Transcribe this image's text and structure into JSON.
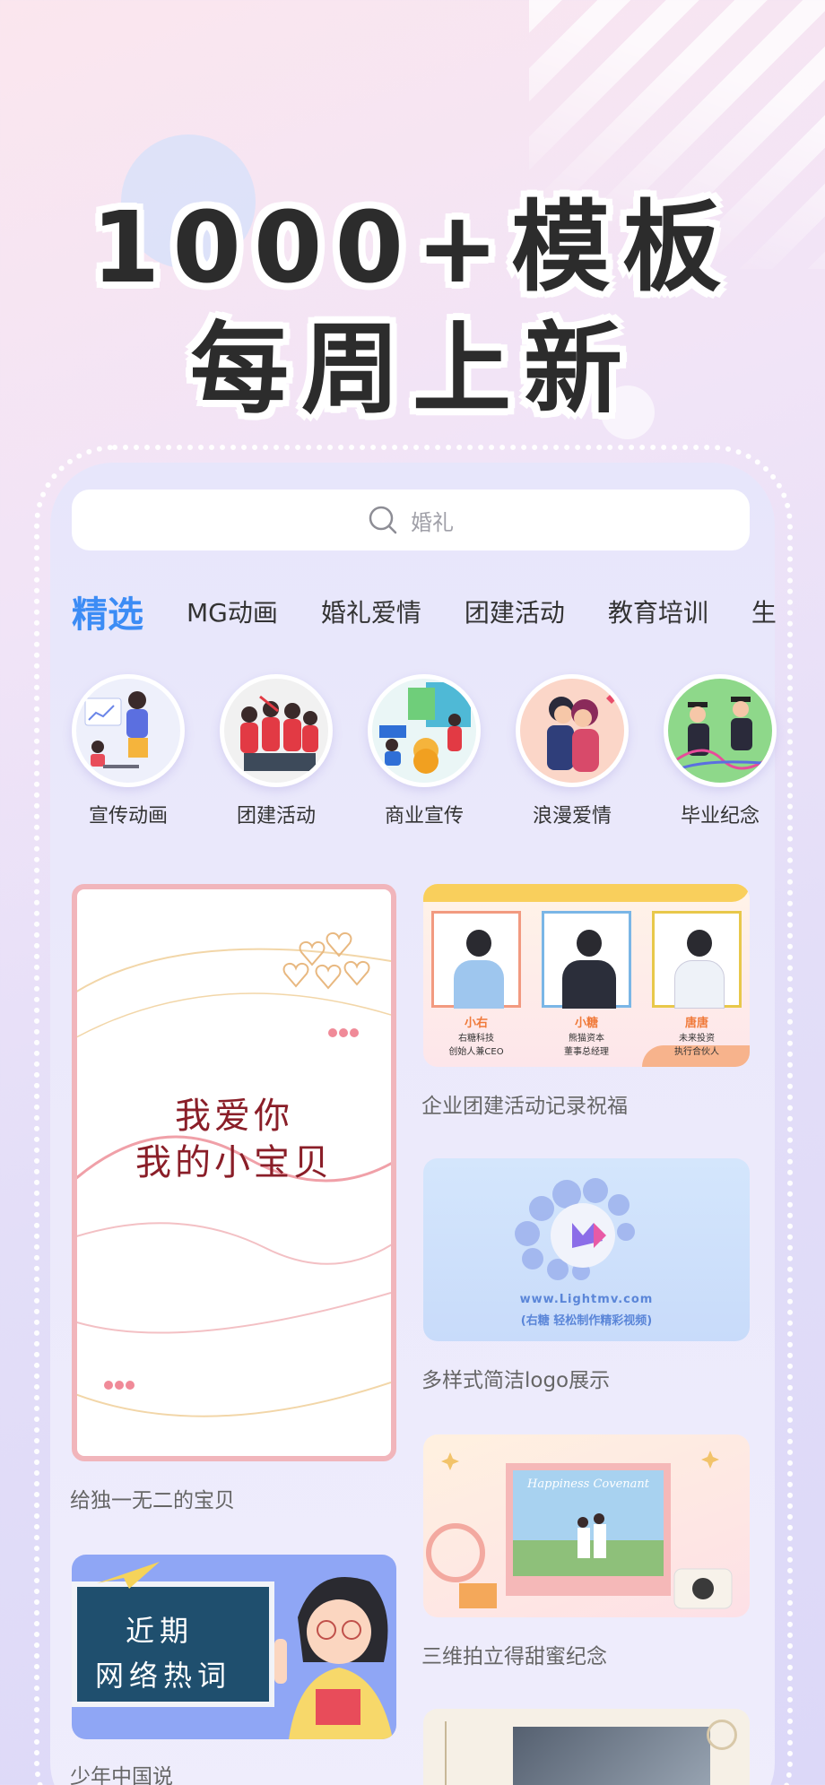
{
  "headline": {
    "line1": "1000+模板",
    "line2": "每周上新"
  },
  "search": {
    "placeholder": "婚礼"
  },
  "tabs": [
    "精选",
    "MG动画",
    "婚礼爱情",
    "团建活动",
    "教育培训",
    "生"
  ],
  "categories": [
    "宣传动画",
    "团建活动",
    "商业宣传",
    "浪漫爱情",
    "毕业纪念"
  ],
  "cards": {
    "love_card": {
      "line1": "我爱你",
      "line2": "我的小宝贝",
      "caption": "给独一无二的宝贝"
    },
    "team_card": {
      "caption": "企业团建活动记录祝福",
      "people": [
        {
          "name": "小右",
          "title1": "右糖科技",
          "title2": "创始人兼CEO"
        },
        {
          "name": "小糖",
          "title1": "熊猫资本",
          "title2": "董事总经理"
        },
        {
          "name": "唐唐",
          "title1": "未来投资",
          "title2": "执行合伙人"
        }
      ]
    },
    "logo_card": {
      "url": "www.Lightmv.com",
      "tagline": "(右糖 轻松制作精彩视频)",
      "caption": "多样式简洁logo展示"
    },
    "photo_card": {
      "script": "Happiness Covenant",
      "caption": "三维拍立得甜蜜纪念"
    },
    "board_card": {
      "line1": "近期",
      "line2": "网络热词",
      "caption": "少年中国说"
    }
  }
}
